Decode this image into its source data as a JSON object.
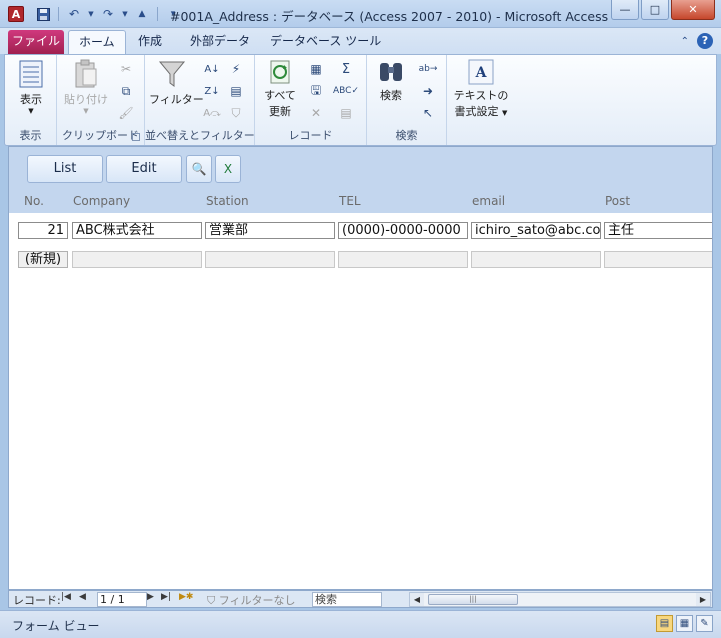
{
  "window": {
    "title": "#001A_Address : データベース (Access 2007 - 2010)  -  Microsoft Access",
    "app_icon_letter": "A",
    "controls": {
      "minimize": "—",
      "maximize": "□",
      "close": "✕"
    }
  },
  "ribbon_tabs": [
    {
      "label": "ファイル"
    },
    {
      "label": "ホーム"
    },
    {
      "label": "作成"
    },
    {
      "label": "外部データ"
    },
    {
      "label": "データベース ツール"
    }
  ],
  "ribbon": {
    "views": {
      "view_label": "表示",
      "group_label": "表示"
    },
    "clipboard": {
      "paste_label": "貼り付け",
      "group_label": "クリップボード"
    },
    "sort_filter": {
      "filter_label": "フィルター",
      "group_label": "並べ替えとフィルター"
    },
    "records": {
      "refresh_label_1": "すべて",
      "refresh_label_2": "更新",
      "group_label": "レコード"
    },
    "find": {
      "find_label": "検索",
      "group_label": "検索"
    },
    "text_format": {
      "label_1": "テキストの",
      "label_2": "書式設定",
      "group_label": ""
    }
  },
  "form": {
    "buttons": {
      "list": "List",
      "edit": "Edit"
    },
    "columns": [
      "No.",
      "Company",
      "Station",
      "TEL",
      "email",
      "Post"
    ],
    "record": {
      "no": "21",
      "company": "ABC株式会社",
      "station": "営業部",
      "tel": "(0000)-0000-0000",
      "email": "ichiro_sato@abc.com",
      "post": "主任"
    },
    "new_record_label": "(新規)"
  },
  "navigation": {
    "record_label": "レコード:",
    "position": "1 / 1",
    "filter_label": "フィルターなし",
    "search_label": "検索"
  },
  "status": {
    "text": "フォーム ビュー"
  },
  "colors": {
    "file_tab": "#b0245a",
    "ribbon_bg": "#e4edf8",
    "form_header": "#c3d6ee"
  }
}
